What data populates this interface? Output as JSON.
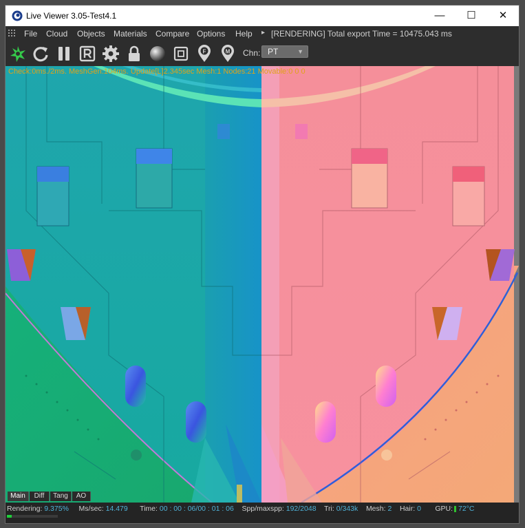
{
  "window": {
    "title": "Live Viewer 3.05-Test4.1",
    "minimize": "—",
    "maximize": "☐",
    "close": "✕"
  },
  "menubar": {
    "items": [
      "File",
      "Cloud",
      "Objects",
      "Materials",
      "Compare",
      "Options",
      "Help"
    ],
    "expand": "▸",
    "status": "[RENDERING] Total export Time = 10475.043 ms"
  },
  "toolbar": {
    "icons": [
      "logo-icon",
      "refresh-icon",
      "pause-icon",
      "region-render-icon",
      "settings-icon",
      "lock-icon",
      "material-ball-icon",
      "focus-frame-icon",
      "focus-pick-icon",
      "material-pick-icon"
    ],
    "channel_label": "Chn:",
    "channel_value": "PT"
  },
  "viewport": {
    "overlay": "Check:0ms./2ms. MeshGen:104ms. Update[L]2.345sec Mesh:1 Nodes:21 Movable:0  0 0",
    "tabs": [
      "Main",
      "Diff",
      "Tang",
      "AO"
    ],
    "active_tab": "Main"
  },
  "statusbar": {
    "rendering_label": "Rendering:",
    "rendering_value": "9.375%",
    "progress": 0.09375,
    "ms_label": "Ms/sec:",
    "ms_value": "14.479",
    "time_label": "Time:",
    "time_value": "00 : 00 : 06/00 : 01 : 06",
    "spp_label": "Spp/maxspp:",
    "spp_value": "192/2048",
    "tri_label": "Tri:",
    "tri_value": "0/343k",
    "mesh_label": "Mesh:",
    "mesh_value": "2",
    "hair_label": "Hair:",
    "hair_value": "0",
    "gpu_label": "GPU:",
    "gpu_value": "72°C"
  },
  "colors": {
    "overlay_text": "#e0a21a",
    "status_value": "#4fb3d9",
    "progress_fill": "#1fcf3a"
  }
}
